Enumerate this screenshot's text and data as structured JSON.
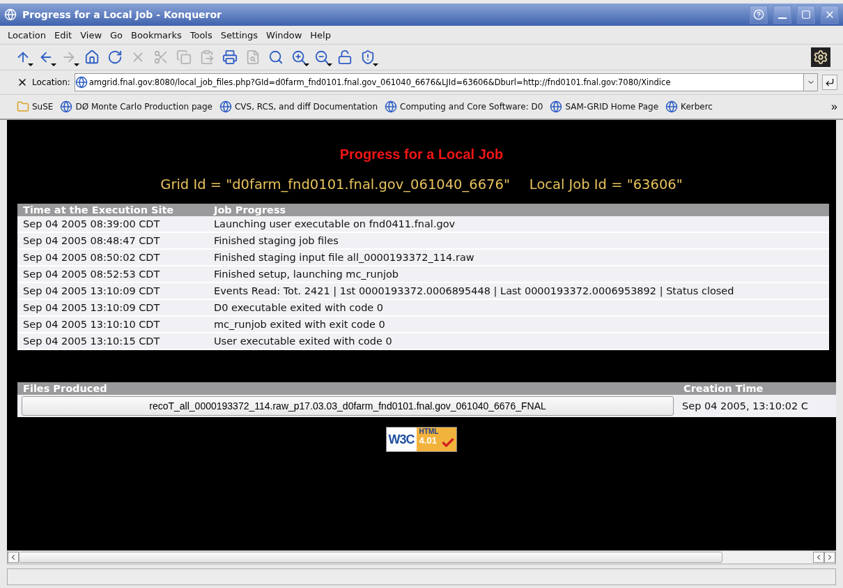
{
  "window": {
    "title": "Progress for a Local Job - Konqueror"
  },
  "menu": [
    "Location",
    "Edit",
    "View",
    "Go",
    "Bookmarks",
    "Tools",
    "Settings",
    "Window",
    "Help"
  ],
  "toolbar": [
    {
      "kind": "up",
      "disabled": false,
      "dropdown": true
    },
    {
      "kind": "back",
      "disabled": false,
      "dropdown": true
    },
    {
      "kind": "forward",
      "disabled": true,
      "dropdown": true
    },
    {
      "kind": "home",
      "disabled": false,
      "dropdown": false
    },
    {
      "kind": "reload",
      "disabled": false,
      "dropdown": false
    },
    {
      "kind": "stop",
      "disabled": true,
      "dropdown": false
    },
    {
      "kind": "cut",
      "disabled": true,
      "dropdown": false
    },
    {
      "kind": "copy",
      "disabled": true,
      "dropdown": false
    },
    {
      "kind": "paste",
      "disabled": true,
      "dropdown": false
    },
    {
      "kind": "print",
      "disabled": false,
      "dropdown": false
    },
    {
      "kind": "print-preview",
      "disabled": true,
      "dropdown": false
    },
    {
      "kind": "find",
      "disabled": false,
      "dropdown": false
    },
    {
      "kind": "zoom-in",
      "disabled": false,
      "dropdown": true
    },
    {
      "kind": "zoom-out",
      "disabled": false,
      "dropdown": true
    },
    {
      "kind": "lock",
      "disabled": false,
      "dropdown": false
    },
    {
      "kind": "security",
      "disabled": false,
      "dropdown": true
    }
  ],
  "location": {
    "label": "Location:",
    "value": "amgrid.fnal.gov:8080/local_job_files.php?GId=d0farm_fnd0101.fnal.gov_061040_6676&LJId=63606&Dburl=http://fnd0101.fnal.gov:7080/Xindice"
  },
  "bookmarks": [
    {
      "kind": "folder",
      "label": "SuSE"
    },
    {
      "kind": "page",
      "label": "DØ Monte Carlo Production page"
    },
    {
      "kind": "page",
      "label": "CVS, RCS, and diff Documentation"
    },
    {
      "kind": "page",
      "label": "Computing and Core Software: D0"
    },
    {
      "kind": "page",
      "label": "SAM-GRID Home Page"
    },
    {
      "kind": "page",
      "label": "Kerberc"
    }
  ],
  "bookmarks_more": "»",
  "page": {
    "heading": "Progress for a Local Job",
    "grid_id": "Grid Id = \"d0farm_fnd0101.fnal.gov_061040_6676\"",
    "local_job_id": "Local Job Id = \"63606\"",
    "progress_table": {
      "columns": [
        "Time at the Execution Site",
        "Job Progress"
      ],
      "rows": [
        [
          "Sep 04 2005 08:39:00 CDT",
          "Launching user executable on fnd0411.fnal.gov"
        ],
        [
          "Sep 04 2005 08:48:47 CDT",
          "Finished staging job files"
        ],
        [
          "Sep 04 2005 08:50:02 CDT",
          "Finished staging input file all_0000193372_114.raw"
        ],
        [
          "Sep 04 2005 08:52:53 CDT",
          "Finished setup, launching mc_runjob"
        ],
        [
          "Sep 04 2005 13:10:09 CDT",
          "Events Read: Tot. 2421 | 1st 0000193372.0006895448 | Last 0000193372.0006953892 | Status closed"
        ],
        [
          "Sep 04 2005 13:10:09 CDT",
          "D0 executable exited with code 0"
        ],
        [
          "Sep 04 2005 13:10:10 CDT",
          "mc_runjob exited with exit code 0"
        ],
        [
          "Sep 04 2005 13:10:15 CDT",
          "User executable exited with code 0"
        ]
      ]
    },
    "files_table": {
      "columns": [
        "Files Produced",
        "Creation Time"
      ],
      "rows": [
        [
          "recoT_all_0000193372_114.raw_p17.03.03_d0farm_fnd0101.fnal.gov_061040_6676_FNAL",
          "Sep 04 2005, 13:10:02 C"
        ]
      ]
    },
    "badge": {
      "w3c": "W3C",
      "html": "HTML",
      "version": "4.01"
    }
  }
}
